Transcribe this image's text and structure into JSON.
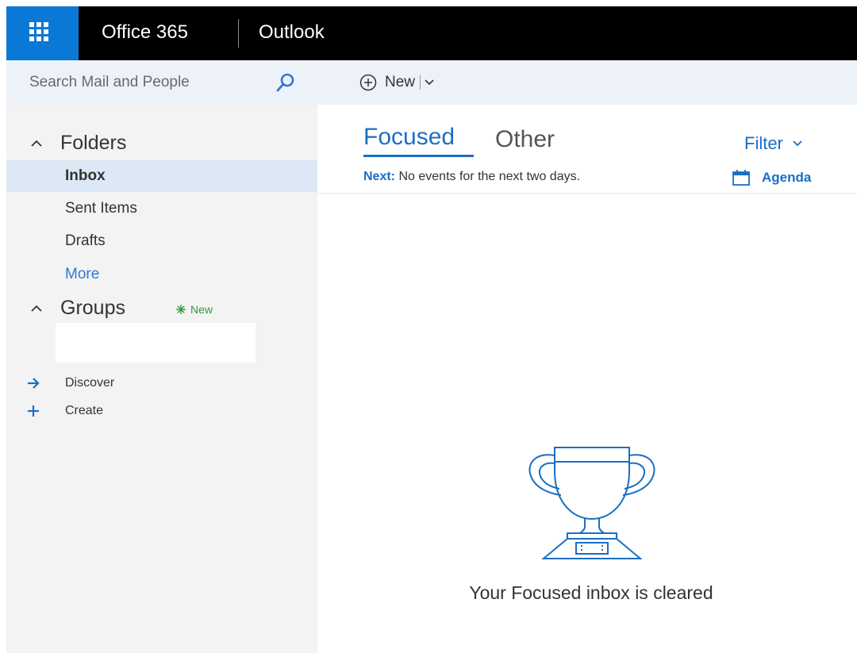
{
  "header": {
    "app_name": "Office 365",
    "module_name": "Outlook"
  },
  "search": {
    "placeholder": "Search Mail and People"
  },
  "folders": {
    "heading": "Folders",
    "items": [
      {
        "label": "Inbox",
        "selected": true
      },
      {
        "label": "Sent Items"
      },
      {
        "label": "Drafts"
      },
      {
        "label": "More"
      }
    ]
  },
  "groups": {
    "heading": "Groups",
    "new_badge": "New",
    "links": [
      {
        "label": "Discover",
        "icon": "arrow-right-icon"
      },
      {
        "label": "Create",
        "icon": "plus-icon"
      }
    ]
  },
  "toolbar": {
    "new_label": "New"
  },
  "pivots": {
    "focused": "Focused",
    "other": "Other",
    "active": "Focused"
  },
  "filter_label": "Filter",
  "agenda": {
    "next_label": "Next:",
    "next_text": "No events for the next two days.",
    "agenda_label": "Agenda"
  },
  "empty_state": {
    "message": "Your Focused inbox is cleared",
    "icon": "trophy-icon"
  },
  "colors": {
    "accent": "#0a78d7",
    "link": "#1b6ec2",
    "new_badge": "#2e9c3c",
    "selected_bg": "#dce8f5"
  }
}
